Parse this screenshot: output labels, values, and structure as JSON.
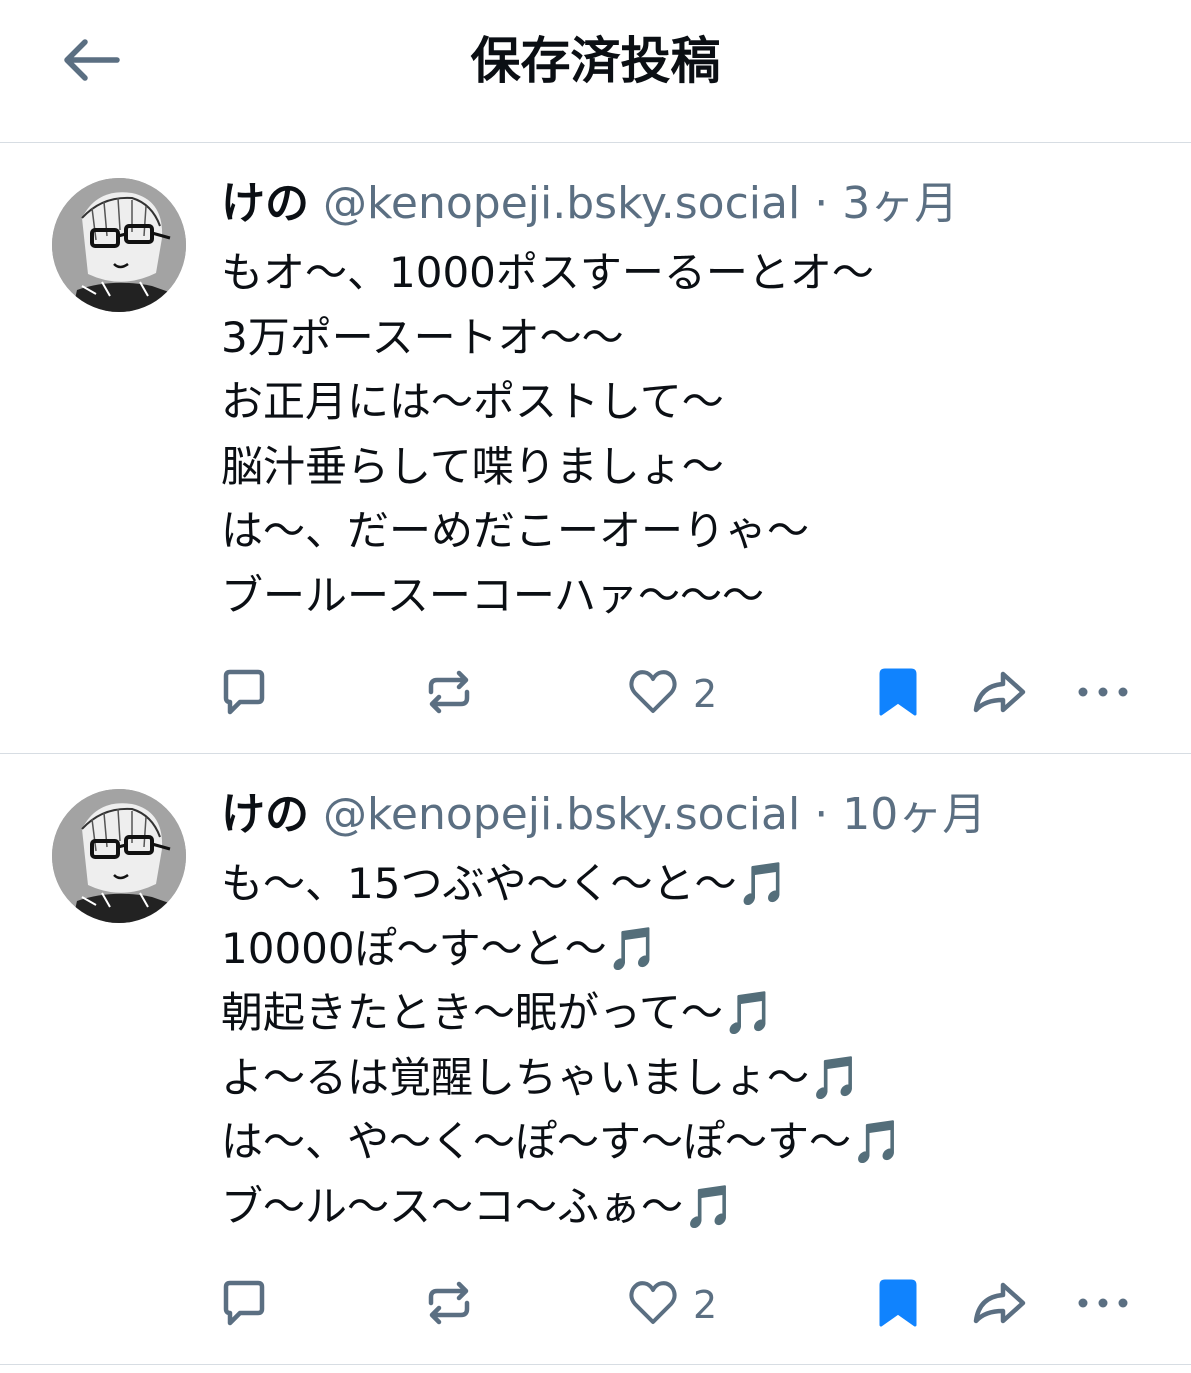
{
  "header": {
    "title": "保存済投稿",
    "back_icon": "arrow-left-icon"
  },
  "colors": {
    "text": "#0b0f14",
    "muted": "#5b6f82",
    "accent": "#1083fe",
    "divider": "#d7dde3"
  },
  "posts": [
    {
      "author": "けの",
      "handle": "@kenopeji.bsky.social",
      "separator": "·",
      "time": "3ヶ月",
      "lines": [
        "もオ〜、1000ポスすーるーとオ〜",
        "3万ポースートオ〜〜",
        "お正月には〜ポストして〜",
        "脳汁垂らして喋りましょ〜",
        "は〜、だーめだこーオーりゃ〜",
        "ブールースーコーハァ〜〜〜"
      ],
      "like_count": "2",
      "bookmarked": true
    },
    {
      "author": "けの",
      "handle": "@kenopeji.bsky.social",
      "separator": "·",
      "time": "10ヶ月",
      "lines": [
        "も〜、15つぶや〜く〜と〜🎵",
        "10000ぽ〜す〜と〜🎵",
        "朝起きたとき〜眠がって〜🎵",
        "よ〜るは覚醒しちゃいましょ〜🎵",
        "は〜、や〜く〜ぽ〜す〜ぽ〜す〜🎵",
        "ブ〜ル〜ス〜コ〜ふぁ〜🎵"
      ],
      "like_count": "2",
      "bookmarked": true
    }
  ]
}
